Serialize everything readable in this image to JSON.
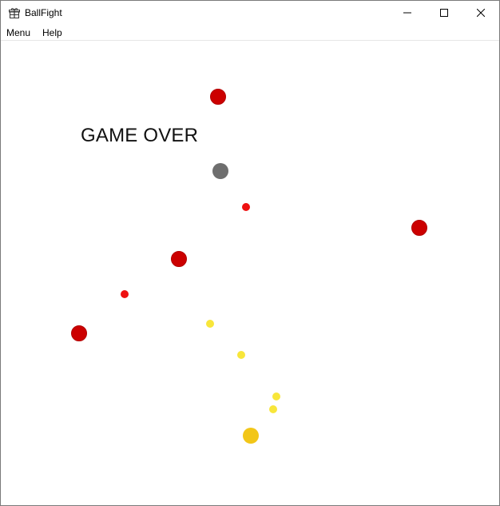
{
  "window": {
    "title": "BallFight",
    "icon": "gift-box-icon"
  },
  "menubar": {
    "items": [
      {
        "label": "Menu"
      },
      {
        "label": "Help"
      }
    ]
  },
  "game": {
    "status_text": "GAME OVER",
    "colors": {
      "enemy_large": "#cc0000",
      "enemy_small": "#ee1111",
      "player": "#6e6e6e",
      "pickup_small": "#f8e63a",
      "pickup_large": "#f2c618"
    }
  }
}
